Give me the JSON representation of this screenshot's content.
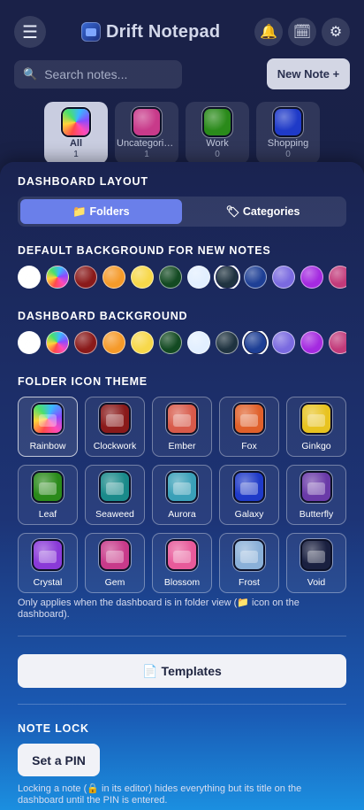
{
  "app": {
    "title": "Drift Notepad",
    "menu_icon": "☰",
    "bell_icon": "🔔",
    "calendar_icon": "🗓",
    "gear_icon": "⚙",
    "search": {
      "icon": "🔍",
      "placeholder": "Search notes..."
    },
    "new_note_label": "New Note +",
    "categories": [
      {
        "name": "All",
        "count": "1",
        "active": true,
        "icon": "rainbow-folder-icon"
      },
      {
        "name": "Uncategorized",
        "count": "1",
        "active": false,
        "icon": "gem-folder-icon"
      },
      {
        "name": "Work",
        "count": "0",
        "active": false,
        "icon": "leaf-folder-icon"
      },
      {
        "name": "Shopping",
        "count": "0",
        "active": false,
        "icon": "galaxy-folder-icon"
      }
    ]
  },
  "settings": {
    "dashboard_layout": {
      "title": "DASHBOARD LAYOUT",
      "folders_label": "📁 Folders",
      "categories_label": "🏷 Categories",
      "selected": "Folders"
    },
    "default_bg": {
      "title": "DEFAULT BACKGROUND FOR NEW NOTES",
      "selected_index": 7
    },
    "dashboard_bg": {
      "title": "DASHBOARD BACKGROUND",
      "selected_index": 8
    },
    "swatch_colors": [
      "#ffffff",
      "rainbow",
      "#8a1a1a",
      "#f59a2a",
      "#f7d84a",
      "#134a22",
      "#e2efff",
      "#1f3340",
      "#1e3f95",
      "#7a6ae0",
      "#a42ae0",
      "#c23a7a"
    ],
    "folder_icon_theme": {
      "title": "FOLDER ICON THEME",
      "items": [
        {
          "name": "Rainbow",
          "icon": "rainbow-folder-icon",
          "color": "rainbow"
        },
        {
          "name": "Clockwork",
          "icon": "clockwork-folder-icon",
          "color": "#8a1a1a"
        },
        {
          "name": "Ember",
          "icon": "ember-folder-icon",
          "color": "#d85a4a"
        },
        {
          "name": "Fox",
          "icon": "fox-folder-icon",
          "color": "#e0602a"
        },
        {
          "name": "Ginkgo",
          "icon": "ginkgo-folder-icon",
          "color": "#e8c320"
        },
        {
          "name": "Leaf",
          "icon": "leaf-folder-icon",
          "color": "#2a8a1a"
        },
        {
          "name": "Seaweed",
          "icon": "seaweed-folder-icon",
          "color": "#1a8a8a"
        },
        {
          "name": "Aurora",
          "icon": "aurora-folder-icon",
          "color": "#3aa0b8"
        },
        {
          "name": "Galaxy",
          "icon": "galaxy-folder-icon",
          "color": "#1f3ac8"
        },
        {
          "name": "Butterfly",
          "icon": "butterfly-folder-icon",
          "color": "#6a3aa8"
        },
        {
          "name": "Crystal",
          "icon": "crystal-folder-icon",
          "color": "#8a3ad8"
        },
        {
          "name": "Gem",
          "icon": "gem-folder-icon",
          "color": "#c83a8a"
        },
        {
          "name": "Blossom",
          "icon": "blossom-folder-icon",
          "color": "#e85a9a"
        },
        {
          "name": "Frost",
          "icon": "frost-folder-icon",
          "color": "#8ab0d8"
        },
        {
          "name": "Void",
          "icon": "void-folder-icon",
          "color": "#1a2040"
        }
      ],
      "selected": "Rainbow",
      "note": "Only applies when the dashboard is in folder view (📁 icon on the dashboard)."
    },
    "templates_label": "📄 Templates",
    "note_lock": {
      "title": "NOTE LOCK",
      "set_pin_label": "Set a PIN",
      "note": "Locking a note (🔒 in its editor) hides everything but its title on the dashboard until the PIN is entered."
    }
  }
}
